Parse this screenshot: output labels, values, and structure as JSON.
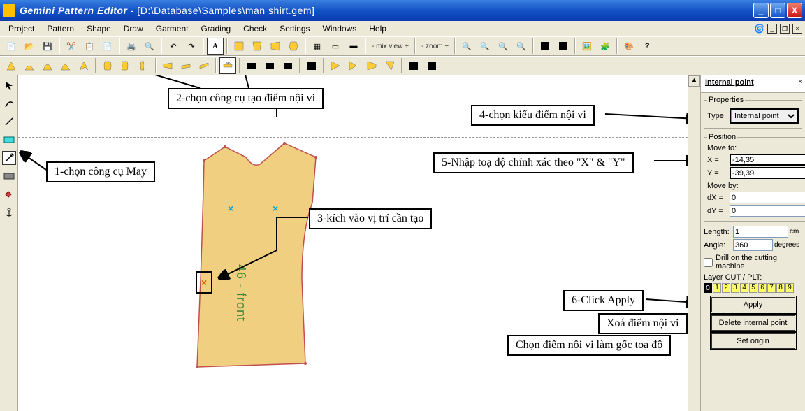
{
  "window": {
    "app_name": "Gemini Pattern Editor",
    "file_path": "[D:\\Database\\Samples\\man shirt.gem]"
  },
  "menu": [
    "Project",
    "Pattern",
    "Shape",
    "Draw",
    "Garment",
    "Grading",
    "Check",
    "Settings",
    "Windows",
    "Help"
  ],
  "toolbar": {
    "mix_view_label": "- mix view +",
    "zoom_label": "- zoom +"
  },
  "canvas": {
    "piece_label": "46 - front"
  },
  "panel": {
    "title": "Internal point",
    "group_properties": "Properties",
    "type_label": "Type",
    "type_value": "Internal point",
    "group_position": "Position",
    "move_to_label": "Move to:",
    "x_label": "X =",
    "x_value": "-14,35",
    "y_label": "Y =",
    "y_value": "-39,39",
    "move_by_label": "Move by:",
    "dx_label": "dX =",
    "dx_value": "0",
    "dy_label": "dY =",
    "dy_value": "0",
    "unit_cm": "cm",
    "length_label": "Length:",
    "length_value": "1",
    "angle_label": "Angle:",
    "angle_value": "360",
    "unit_degrees": "degrees",
    "drill_label": "Drill on the cutting machine",
    "layer_label": "Layer CUT / PLT:",
    "layers": [
      "0",
      "1",
      "2",
      "3",
      "4",
      "5",
      "6",
      "7",
      "8",
      "9"
    ],
    "apply_label": "Apply",
    "delete_label": "Delete internal point",
    "origin_label": "Set origin"
  },
  "annotations": {
    "a1": "1-chọn công cụ May",
    "a2": "2-chọn công cụ tạo điểm nội vi",
    "a3": "3-kích vào vị trí cần tạo",
    "a4": "4-chọn kiểu điểm nội vi",
    "a5": "5-Nhập toạ độ chính xác theo \"X\" & \"Y\"",
    "a6": "6-Click Apply",
    "a7": "Xoá điểm nội vi",
    "a8": "Chọn điểm nội vi làm gốc toạ độ"
  }
}
